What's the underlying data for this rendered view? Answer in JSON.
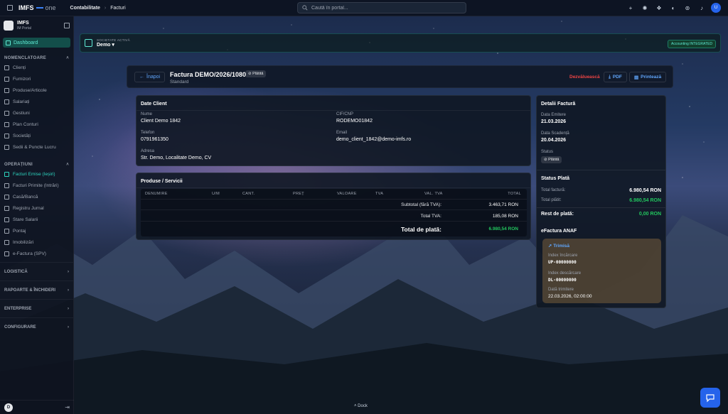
{
  "topbar": {
    "brand": "IMFS",
    "brand_suffix": "one",
    "breadcrumb": [
      "Contabilitate",
      "Facturi"
    ],
    "search_placeholder": "Caută în portal..."
  },
  "sidebar": {
    "app_name": "IMFS",
    "app_sub": "IM Portal",
    "dashboard": "Dashboard",
    "sections": [
      {
        "title": "NOMENCLATOARE",
        "items": [
          "Clienți",
          "Furnizori",
          "Produse/Articole",
          "Salariați",
          "Gestiuni",
          "Plan Conturi",
          "Societăți",
          "Sedii & Puncte Lucru"
        ]
      },
      {
        "title": "OPERAȚIUNI",
        "items": [
          "Facturi Emise (Ieșiri)",
          "Facturi Primite (Intrări)",
          "Casă/Bancă",
          "Registru Jurnal",
          "Stare Salarii",
          "Pontaj",
          "Imobilizări",
          "e-Factura (SPV)"
        ]
      }
    ],
    "groups": [
      "LOGISTICĂ",
      "RAPOARTE & ÎNCHIDERI",
      "ENTERPRISE",
      "CONFIGURARE"
    ],
    "user_initial": "D"
  },
  "company": {
    "label": "SOCIETATE ACTIVĂ",
    "name": "Demo",
    "badge": "Accounting INTEGRATED"
  },
  "invoice": {
    "back": "Înapoi",
    "title": "Factura DEMO/2026/1080",
    "status": "Plătită",
    "subtitle": "Standard",
    "btn_cancel": "Dezvăluească",
    "btn_pdf": "PDF",
    "btn_send": "Printează"
  },
  "client": {
    "title": "Date Client",
    "name_label": "Nume",
    "name": "Client Demo 1842",
    "cif_label": "CIF/CNP",
    "cif": "RODEMO01842",
    "phone_label": "Telefon",
    "phone": "0791961350",
    "email_label": "Email",
    "email": "demo_client_1842@demo-imfs.ro",
    "address_label": "Adresa",
    "address": "Str. Demo, Localitate Demo, CV"
  },
  "products": {
    "title": "Produse / Servicii",
    "columns": [
      "DENUMIRE",
      "U/M",
      "CANT.",
      "PREȚ",
      "VALOARE",
      "TVA",
      "VAL. TVA",
      "TOTAL"
    ],
    "subtotal_label": "Subtotal (fără TVA):",
    "subtotal": "3.463,71 RON",
    "vat_label": "Total TVA:",
    "vat": "185,08 RON",
    "total_label": "Total de plată:",
    "total": "6.980,54 RON"
  },
  "details": {
    "title": "Detalii Factură",
    "issue_label": "Data Emitere",
    "issue": "21.03.2026",
    "due_label": "Data Scadență",
    "due": "20.04.2026",
    "status_label": "Status",
    "status": "Plătită",
    "pay_title": "Status Plată",
    "total_label": "Total factură:",
    "total": "6.980,54 RON",
    "paid_label": "Total plătit:",
    "paid": "6.980,54 RON",
    "rest_label": "Rest de plată:",
    "rest": "0,00 RON",
    "efact_title": "eFactura ANAF",
    "efact_status": "Trimisă",
    "upload_label": "Index încărcare",
    "upload": "UP-00000000",
    "download_label": "Index descărcare",
    "download": "DL-00000000",
    "sent_label": "Dată trimitere",
    "sent": "22.03.2026, 02:00:00"
  },
  "footer": {
    "dock": "Dock"
  }
}
